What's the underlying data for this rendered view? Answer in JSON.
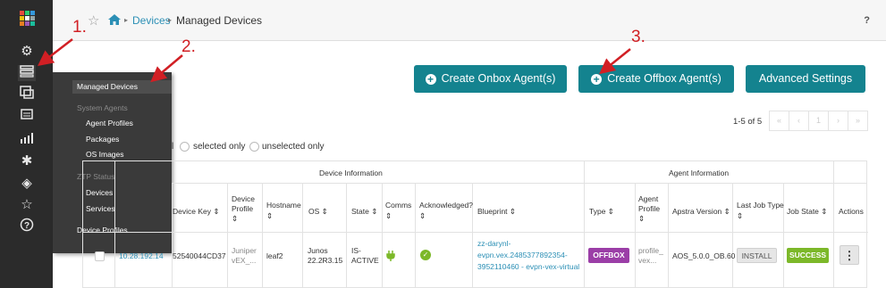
{
  "app": {
    "logo_colors": [
      "#e84c3d",
      "#2ecc71",
      "#3498db",
      "#f1c40f",
      "#ffffff",
      "#95a5a6",
      "#e67e22",
      "#9b59b6",
      "#1abc9c"
    ]
  },
  "sidebar": {
    "icons": [
      "dashboard-icon",
      "devices-icon",
      "design-icon",
      "resources-icon",
      "analytics-icon",
      "platform-icon",
      "layers-icon",
      "favorites-icon",
      "help-icon"
    ]
  },
  "flyout": {
    "managed_devices": "Managed Devices",
    "system_agents": "System Agents",
    "agent_profiles": "Agent Profiles",
    "packages": "Packages",
    "os_images": "OS Images",
    "ztp_status": "ZTP Status",
    "ztp_devices": "Devices",
    "ztp_services": "Services",
    "device_profiles": "Device Profiles"
  },
  "breadcrumb": {
    "parent": "Devices",
    "current": "Managed Devices",
    "help": "?"
  },
  "actions": {
    "create_onbox": "Create Onbox Agent(s)",
    "create_offbox": "Create Offbox Agent(s)",
    "advanced_settings": "Advanced Settings"
  },
  "pagination": {
    "count": "1-5 of 5",
    "first": "«",
    "prev": "‹",
    "page": "1",
    "next": "›",
    "last": "»"
  },
  "filter": {
    "selected_only": "selected only",
    "unselected_only": "unselected only",
    "all_suffix": "l"
  },
  "table": {
    "group_device_info": "Device Information",
    "group_agent_info": "Agent Information",
    "headers": {
      "device_key": "Device Key ⇕",
      "device_profile": [
        "Device",
        "Profile",
        "⇕"
      ],
      "hostname": [
        "Hostname",
        "⇕"
      ],
      "os": "OS ⇕",
      "state": "State ⇕",
      "comms": [
        "Comms",
        "⇕"
      ],
      "acknowledged": [
        "Acknowledged?",
        "⇕"
      ],
      "blueprint": "Blueprint ⇕",
      "type": "Type ⇕",
      "agent_profile": [
        "Agent",
        "Profile",
        "⇕"
      ],
      "apstra_version": "Apstra Version ⇕",
      "last_job_type": [
        "Last Job Type",
        "⇕"
      ],
      "job_state": "Job State ⇕",
      "actions": "Actions"
    },
    "row": {
      "ip": "10.28.192.14",
      "device_key": "52540044CD37",
      "device_profile": [
        "Juniper",
        "vEX_..."
      ],
      "hostname": "leaf2",
      "os": [
        "Junos",
        "22.2R3.15"
      ],
      "state": [
        "IS-",
        "ACTIVE"
      ],
      "blueprint": [
        "zz-darynl-",
        "evpn.vex.2485377892354-",
        "3952110460 - evpn-vex-virtual"
      ],
      "type": "OFFBOX",
      "agent_profile": [
        "profile_",
        "vex..."
      ],
      "apstra_version": "AOS_5.0.0_OB.60",
      "last_job_type": "INSTALL",
      "job_state": "SUCCESS",
      "menu": "⋮"
    }
  },
  "annotations": {
    "one": "1.",
    "two": "2.",
    "three": "3."
  },
  "colors": {
    "accent": "#14838f",
    "offbox": "#9b3ea7",
    "success": "#7cb829",
    "annotation": "#d11f24",
    "link": "#2b8fb5"
  }
}
